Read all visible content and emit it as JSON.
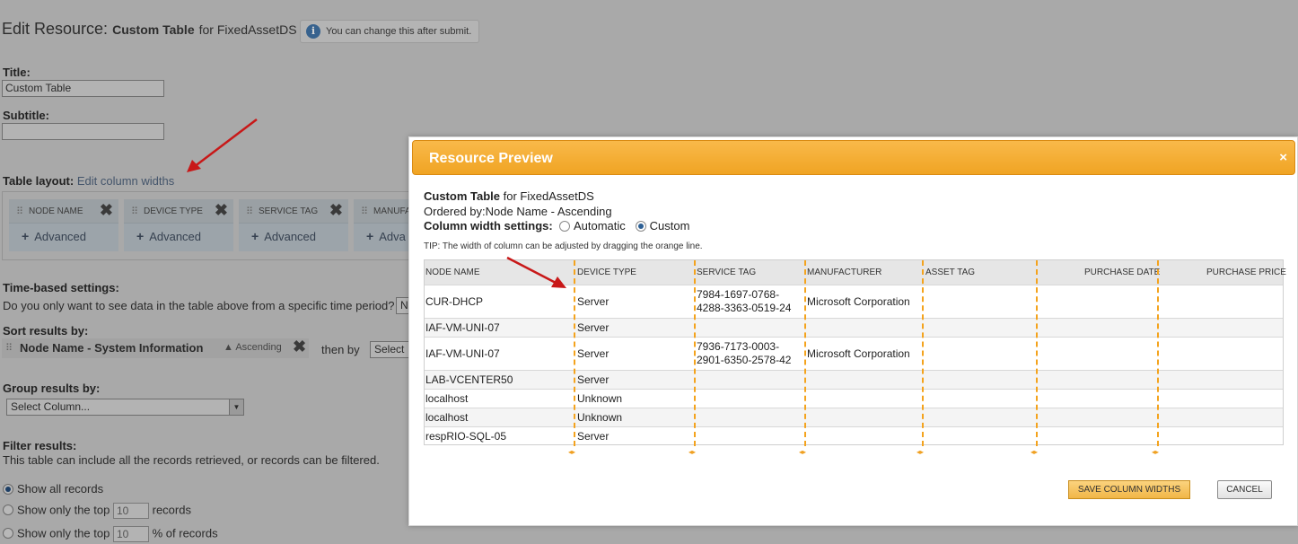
{
  "page": {
    "heading_prefix": "Edit Resource:",
    "heading_resource": "Custom Table",
    "heading_for": "for FixedAssetDS",
    "hint": "You can change this after submit.",
    "title_label": "Title:",
    "title_value": "Custom Table",
    "subtitle_label": "Subtitle:",
    "subtitle_value": "",
    "table_layout_label": "Table layout:",
    "edit_widths_link": "Edit column widths",
    "layout_columns": [
      {
        "name": "NODE NAME",
        "advanced": "Advanced"
      },
      {
        "name": "DEVICE TYPE",
        "advanced": "Advanced"
      },
      {
        "name": "SERVICE TAG",
        "advanced": "Advanced"
      },
      {
        "name": "MANUFA",
        "advanced": "Adva"
      }
    ],
    "time_label": "Time-based settings:",
    "time_question": "Do you only want to see data in the table above from a specific time period?",
    "time_select": "N",
    "sort_label": "Sort results by:",
    "sort_field": "Node Name - System Information",
    "sort_direction": "Ascending",
    "then_by": "then by",
    "then_select": "Select",
    "group_label": "Group results by:",
    "group_select": "Select Column...",
    "filter_label": "Filter results:",
    "filter_desc": "This table can include all the records retrieved, or records can be filtered.",
    "opt_all": "Show all records",
    "opt_top": "Show only the top",
    "opt_top_value": "10",
    "opt_top_unit": "records",
    "opt_pct": "Show only the top",
    "opt_pct_value": "10",
    "opt_pct_unit": "% of records"
  },
  "modal": {
    "title": "Resource Preview",
    "close": "×",
    "resource_name": "Custom Table",
    "resource_for": "for FixedAssetDS",
    "ordered_by": "Ordered by:Node Name - Ascending",
    "width_label": "Column width settings:",
    "opt_automatic": "Automatic",
    "opt_custom": "Custom",
    "tip": "TIP: The width of column can be adjusted by dragging the orange line.",
    "columns": [
      "NODE NAME",
      "DEVICE TYPE",
      "SERVICE TAG",
      "MANUFACTURER",
      "ASSET TAG",
      "PURCHASE DATE",
      "PURCHASE PRICE"
    ],
    "rows": [
      {
        "node": "CUR-DHCP",
        "type": "Server",
        "tag1": "7984-1697-0768-",
        "tag2": "4288-3363-0519-24",
        "mfr": "Microsoft Corporation"
      },
      {
        "node": "IAF-VM-UNI-07",
        "type": "Server",
        "tag1": "",
        "tag2": "",
        "mfr": ""
      },
      {
        "node": "IAF-VM-UNI-07",
        "type": "Server",
        "tag1": "7936-7173-0003-",
        "tag2": "2901-6350-2578-42",
        "mfr": "Microsoft Corporation"
      },
      {
        "node": "LAB-VCENTER50",
        "type": "Server",
        "tag1": "",
        "tag2": "",
        "mfr": ""
      },
      {
        "node": "localhost",
        "type": "Unknown",
        "tag1": "",
        "tag2": "",
        "mfr": ""
      },
      {
        "node": "localhost",
        "type": "Unknown",
        "tag1": "",
        "tag2": "",
        "mfr": ""
      },
      {
        "node": "respRIO-SQL-05",
        "type": "Server",
        "tag1": "",
        "tag2": "",
        "mfr": ""
      }
    ],
    "save_button": "SAVE COLUMN WIDTHS",
    "cancel_button": "CANCEL"
  },
  "colors": {
    "accent_orange": "#f0a423",
    "overlay_gray": "#a9a9a9",
    "arrow_red": "#c81818"
  }
}
